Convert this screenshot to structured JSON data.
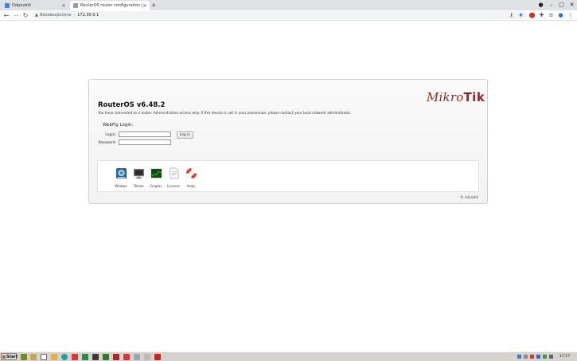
{
  "tabs": [
    {
      "label": "Odpovědi",
      "favicon_color": "#3b82f6"
    },
    {
      "label": "RouterOS router configuration page",
      "favicon_color": "#777777"
    }
  ],
  "new_tab_symbol": "+",
  "address": {
    "security_label": "Nezabezpečeno",
    "url": "172.30.0.1"
  },
  "page": {
    "logo_prefix": "Mikro",
    "logo_suffix": "Tik",
    "brand_color": "#8b2a2a",
    "title": "RouterOS v6.48.2",
    "notice": "You have connected to a router. Administrative access only. If this device is not in your possession, please contact your local network administrator.",
    "webfig_title": "WebFig Login:",
    "login_label": "Login:",
    "login_value": "",
    "password_label": "Password:",
    "password_value": "",
    "login_button": "Log in",
    "tools": [
      {
        "label": "Winbox",
        "icon": "winbox-icon"
      },
      {
        "label": "Telnet",
        "icon": "telnet-icon"
      },
      {
        "label": "Graphs",
        "icon": "graphs-icon"
      },
      {
        "label": "License",
        "icon": "license-icon"
      },
      {
        "label": "Help",
        "icon": "help-icon"
      }
    ],
    "copyright": "© mikrotik"
  },
  "taskbar": {
    "start_label": "Start",
    "clock": "17:17"
  }
}
